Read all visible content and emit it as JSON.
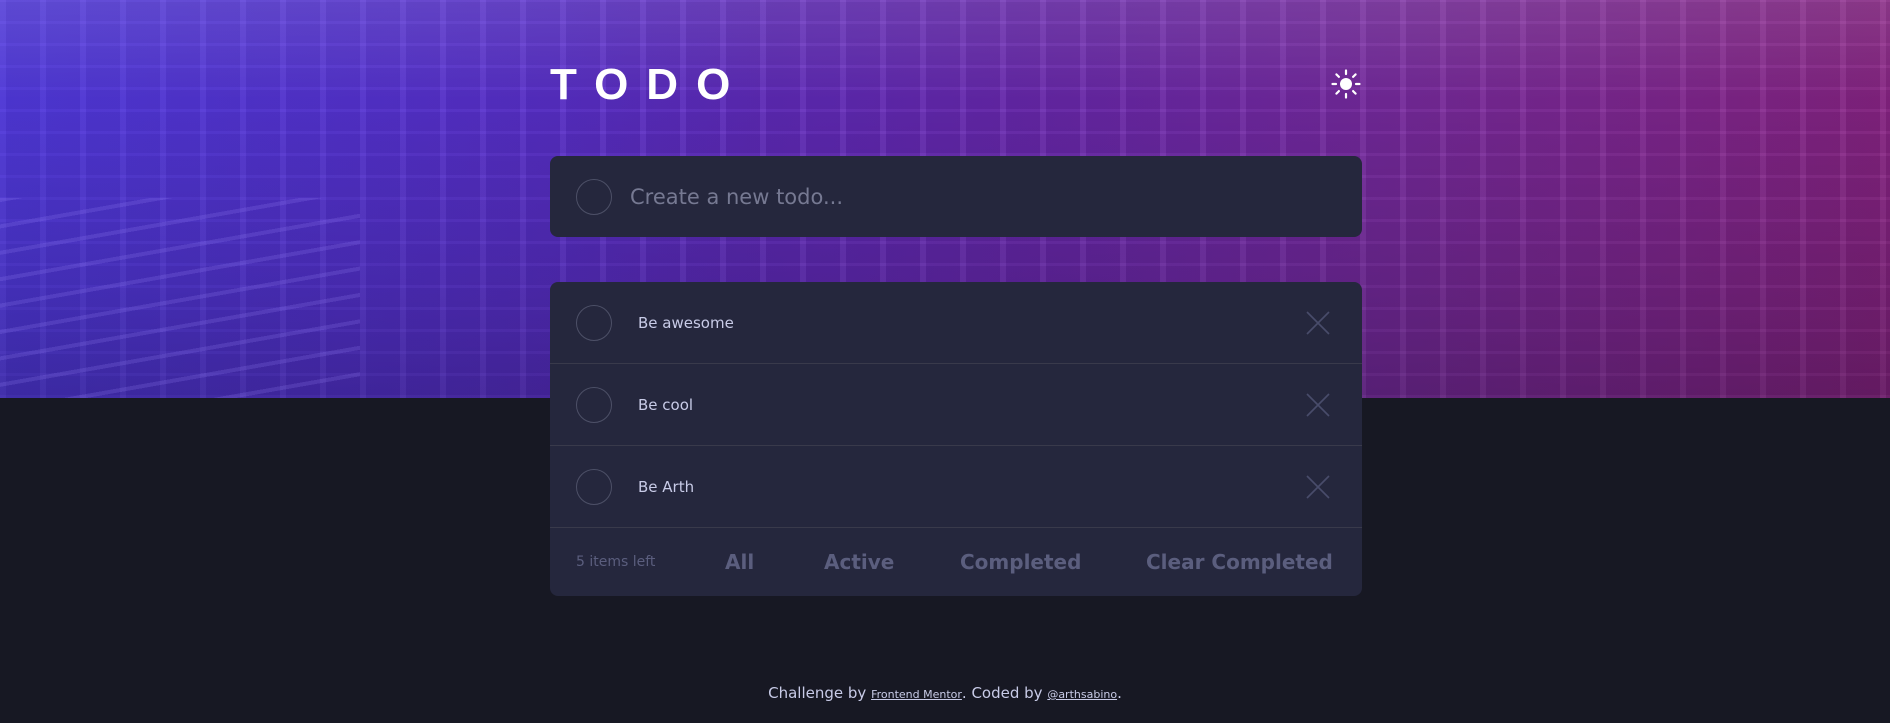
{
  "header": {
    "title": "TODO",
    "theme_icon": "sun-icon"
  },
  "new_todo": {
    "placeholder": "Create a new todo..."
  },
  "todos": [
    {
      "text": "Be awesome",
      "completed": false
    },
    {
      "text": "Be cool",
      "completed": false
    },
    {
      "text": "Be Arth",
      "completed": false
    }
  ],
  "footer": {
    "items_left": "5 items left",
    "filters": {
      "all": "All",
      "active": "Active",
      "completed": "Completed"
    },
    "clear_completed": "Clear Completed"
  },
  "credits": {
    "prefix": "Challenge by ",
    "challenge_link": "Frontend Mentor",
    "middle": ". Coded by ",
    "author_link": "@arthsabino",
    "suffix": "."
  },
  "colors": {
    "card": "#25273d",
    "page_bg": "#171823",
    "text": "#c8cbe7",
    "muted": "#5b5e7e",
    "gradient_start": "#4a30d6",
    "gradient_end": "#8a2486"
  }
}
